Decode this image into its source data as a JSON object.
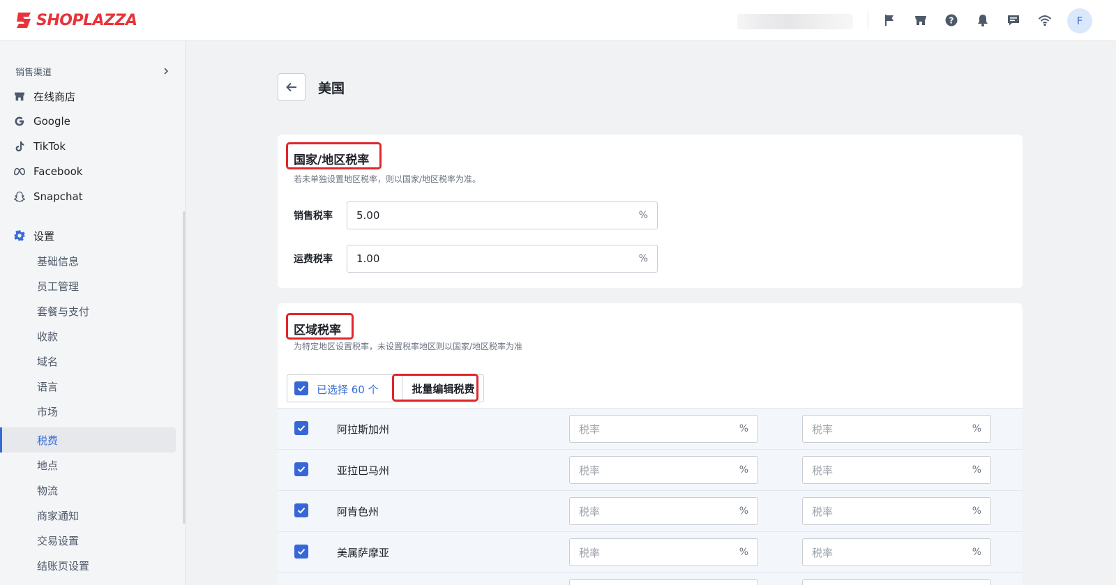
{
  "header": {
    "brand": "SHOPLAZZA",
    "avatar_initial": "F",
    "icons": [
      "flag-icon",
      "store-icon",
      "help-icon",
      "bell-icon",
      "chat-icon",
      "wifi-icon"
    ]
  },
  "sidebar": {
    "channels_label": "销售渠道",
    "channels": [
      {
        "label": "在线商店",
        "icon": "store-icon"
      },
      {
        "label": "Google",
        "icon": "google-icon"
      },
      {
        "label": "TikTok",
        "icon": "tiktok-icon"
      },
      {
        "label": "Facebook",
        "icon": "meta-icon"
      },
      {
        "label": "Snapchat",
        "icon": "snapchat-icon"
      }
    ],
    "settings_label": "设置",
    "settings_items": [
      "基础信息",
      "员工管理",
      "套餐与支付",
      "收款",
      "域名",
      "语言",
      "市场",
      "税费",
      "地点",
      "物流",
      "商家通知",
      "交易设置",
      "结账页设置"
    ],
    "active_item": "税费"
  },
  "page": {
    "title": "美国"
  },
  "country_rate": {
    "title": "国家/地区税率",
    "description": "若未单独设置地区税率，则以国家/地区税率为准。",
    "sales_label": "销售税率",
    "sales_value": "5.00",
    "shipping_label": "运费税率",
    "shipping_value": "1.00",
    "suffix": "%"
  },
  "region_rate": {
    "title": "区域税率",
    "description": "为特定地区设置税率，未设置税率地区则以国家/地区税率为准",
    "selected_text": "已选择 60 个",
    "bulk_edit_label": "批量编辑税费",
    "placeholder": "税率",
    "suffix": "%",
    "rows": [
      {
        "name": "阿拉斯加州",
        "checked": true
      },
      {
        "name": "亚拉巴马州",
        "checked": true
      },
      {
        "name": "阿肯色州",
        "checked": true
      },
      {
        "name": "美属萨摩亚",
        "checked": true
      }
    ]
  },
  "colors": {
    "accent": "#356bd8",
    "highlight": "#e0262c",
    "brand": "#e8333b"
  }
}
